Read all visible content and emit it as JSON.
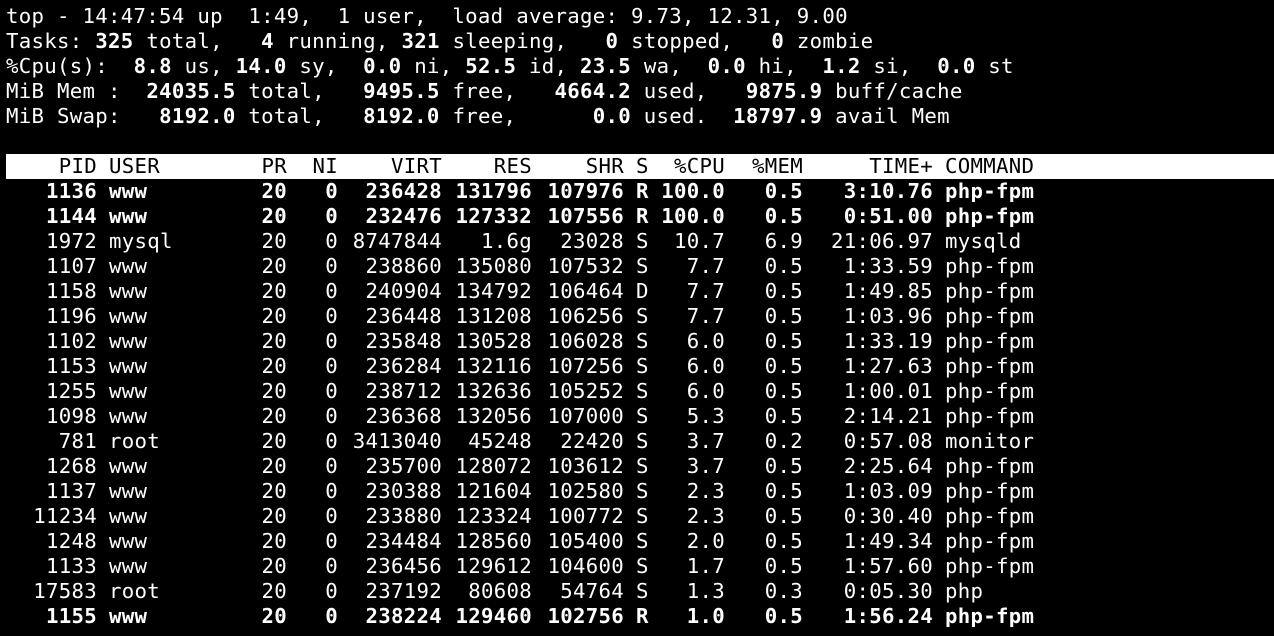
{
  "summary": {
    "uptime": "top - 14:47:54 up  1:49,  1 user,  load average: 9.73, 12.31, 9.00",
    "tasks": {
      "label": "Tasks: ",
      "total": "325",
      "total_label": " total,   ",
      "running": "4",
      "running_label": " running, ",
      "sleeping": "321",
      "sleeping_label": " sleeping,   ",
      "stopped": "0",
      "stopped_label": " stopped,   ",
      "zombie": "0",
      "zombie_label": " zombie"
    },
    "cpu": {
      "label": "%Cpu(s):  ",
      "us": "8.8",
      "us_label": " us, ",
      "sy": "14.0",
      "sy_label": " sy,  ",
      "ni": "0.0",
      "ni_label": " ni, ",
      "id": "52.5",
      "id_label": " id, ",
      "wa": "23.5",
      "wa_label": " wa,  ",
      "hi": "0.0",
      "hi_label": " hi,  ",
      "si": "1.2",
      "si_label": " si,  ",
      "st": "0.0",
      "st_label": " st"
    },
    "mem": {
      "label": "MiB Mem :  ",
      "total": "24035.5",
      "total_label": " total,   ",
      "free": "9495.5",
      "free_label": " free,   ",
      "used": "4664.2",
      "used_label": " used,   ",
      "buff": "9875.9",
      "buff_label": " buff/cache"
    },
    "swap": {
      "label": "MiB Swap:   ",
      "total": "8192.0",
      "total_label": " total,   ",
      "free": "8192.0",
      "free_label": " free,      ",
      "used": "0.0",
      "used_label": " used.  ",
      "avail": "18797.9",
      "avail_label": " avail Mem"
    }
  },
  "columns": {
    "pid": "PID",
    "user": "USER",
    "pr": "PR",
    "ni": "NI",
    "virt": "VIRT",
    "res": "RES",
    "shr": "SHR",
    "s": "S",
    "cpu": "%CPU",
    "mem": "%MEM",
    "time": "TIME+",
    "command": "COMMAND"
  },
  "processes": [
    {
      "pid": "1136",
      "user": "www",
      "pr": "20",
      "ni": "0",
      "virt": "236428",
      "res": "131796",
      "shr": "107976",
      "s": "R",
      "cpu": "100.0",
      "mem": "0.5",
      "time": "3:10.76",
      "command": "php-fpm"
    },
    {
      "pid": "1144",
      "user": "www",
      "pr": "20",
      "ni": "0",
      "virt": "232476",
      "res": "127332",
      "shr": "107556",
      "s": "R",
      "cpu": "100.0",
      "mem": "0.5",
      "time": "0:51.00",
      "command": "php-fpm"
    },
    {
      "pid": "1972",
      "user": "mysql",
      "pr": "20",
      "ni": "0",
      "virt": "8747844",
      "res": "1.6g",
      "shr": "23028",
      "s": "S",
      "cpu": "10.7",
      "mem": "6.9",
      "time": "21:06.97",
      "command": "mysqld"
    },
    {
      "pid": "1107",
      "user": "www",
      "pr": "20",
      "ni": "0",
      "virt": "238860",
      "res": "135080",
      "shr": "107532",
      "s": "S",
      "cpu": "7.7",
      "mem": "0.5",
      "time": "1:33.59",
      "command": "php-fpm"
    },
    {
      "pid": "1158",
      "user": "www",
      "pr": "20",
      "ni": "0",
      "virt": "240904",
      "res": "134792",
      "shr": "106464",
      "s": "D",
      "cpu": "7.7",
      "mem": "0.5",
      "time": "1:49.85",
      "command": "php-fpm"
    },
    {
      "pid": "1196",
      "user": "www",
      "pr": "20",
      "ni": "0",
      "virt": "236448",
      "res": "131208",
      "shr": "106256",
      "s": "S",
      "cpu": "7.7",
      "mem": "0.5",
      "time": "1:03.96",
      "command": "php-fpm"
    },
    {
      "pid": "1102",
      "user": "www",
      "pr": "20",
      "ni": "0",
      "virt": "235848",
      "res": "130528",
      "shr": "106028",
      "s": "S",
      "cpu": "6.0",
      "mem": "0.5",
      "time": "1:33.19",
      "command": "php-fpm"
    },
    {
      "pid": "1153",
      "user": "www",
      "pr": "20",
      "ni": "0",
      "virt": "236284",
      "res": "132116",
      "shr": "107256",
      "s": "S",
      "cpu": "6.0",
      "mem": "0.5",
      "time": "1:27.63",
      "command": "php-fpm"
    },
    {
      "pid": "1255",
      "user": "www",
      "pr": "20",
      "ni": "0",
      "virt": "238712",
      "res": "132636",
      "shr": "105252",
      "s": "S",
      "cpu": "6.0",
      "mem": "0.5",
      "time": "1:00.01",
      "command": "php-fpm"
    },
    {
      "pid": "1098",
      "user": "www",
      "pr": "20",
      "ni": "0",
      "virt": "236368",
      "res": "132056",
      "shr": "107000",
      "s": "S",
      "cpu": "5.3",
      "mem": "0.5",
      "time": "2:14.21",
      "command": "php-fpm"
    },
    {
      "pid": "781",
      "user": "root",
      "pr": "20",
      "ni": "0",
      "virt": "3413040",
      "res": "45248",
      "shr": "22420",
      "s": "S",
      "cpu": "3.7",
      "mem": "0.2",
      "time": "0:57.08",
      "command": "monitor"
    },
    {
      "pid": "1268",
      "user": "www",
      "pr": "20",
      "ni": "0",
      "virt": "235700",
      "res": "128072",
      "shr": "103612",
      "s": "S",
      "cpu": "3.7",
      "mem": "0.5",
      "time": "2:25.64",
      "command": "php-fpm"
    },
    {
      "pid": "1137",
      "user": "www",
      "pr": "20",
      "ni": "0",
      "virt": "230388",
      "res": "121604",
      "shr": "102580",
      "s": "S",
      "cpu": "2.3",
      "mem": "0.5",
      "time": "1:03.09",
      "command": "php-fpm"
    },
    {
      "pid": "11234",
      "user": "www",
      "pr": "20",
      "ni": "0",
      "virt": "233880",
      "res": "123324",
      "shr": "100772",
      "s": "S",
      "cpu": "2.3",
      "mem": "0.5",
      "time": "0:30.40",
      "command": "php-fpm"
    },
    {
      "pid": "1248",
      "user": "www",
      "pr": "20",
      "ni": "0",
      "virt": "234484",
      "res": "128560",
      "shr": "105400",
      "s": "S",
      "cpu": "2.0",
      "mem": "0.5",
      "time": "1:49.34",
      "command": "php-fpm"
    },
    {
      "pid": "1133",
      "user": "www",
      "pr": "20",
      "ni": "0",
      "virt": "236456",
      "res": "129612",
      "shr": "104600",
      "s": "S",
      "cpu": "1.7",
      "mem": "0.5",
      "time": "1:57.60",
      "command": "php-fpm"
    },
    {
      "pid": "17583",
      "user": "root",
      "pr": "20",
      "ni": "0",
      "virt": "237192",
      "res": "80608",
      "shr": "54764",
      "s": "S",
      "cpu": "1.3",
      "mem": "0.3",
      "time": "0:05.30",
      "command": "php"
    },
    {
      "pid": "1155",
      "user": "www",
      "pr": "20",
      "ni": "0",
      "virt": "238224",
      "res": "129460",
      "shr": "102756",
      "s": "R",
      "cpu": "1.0",
      "mem": "0.5",
      "time": "1:56.24",
      "command": "php-fpm"
    }
  ]
}
